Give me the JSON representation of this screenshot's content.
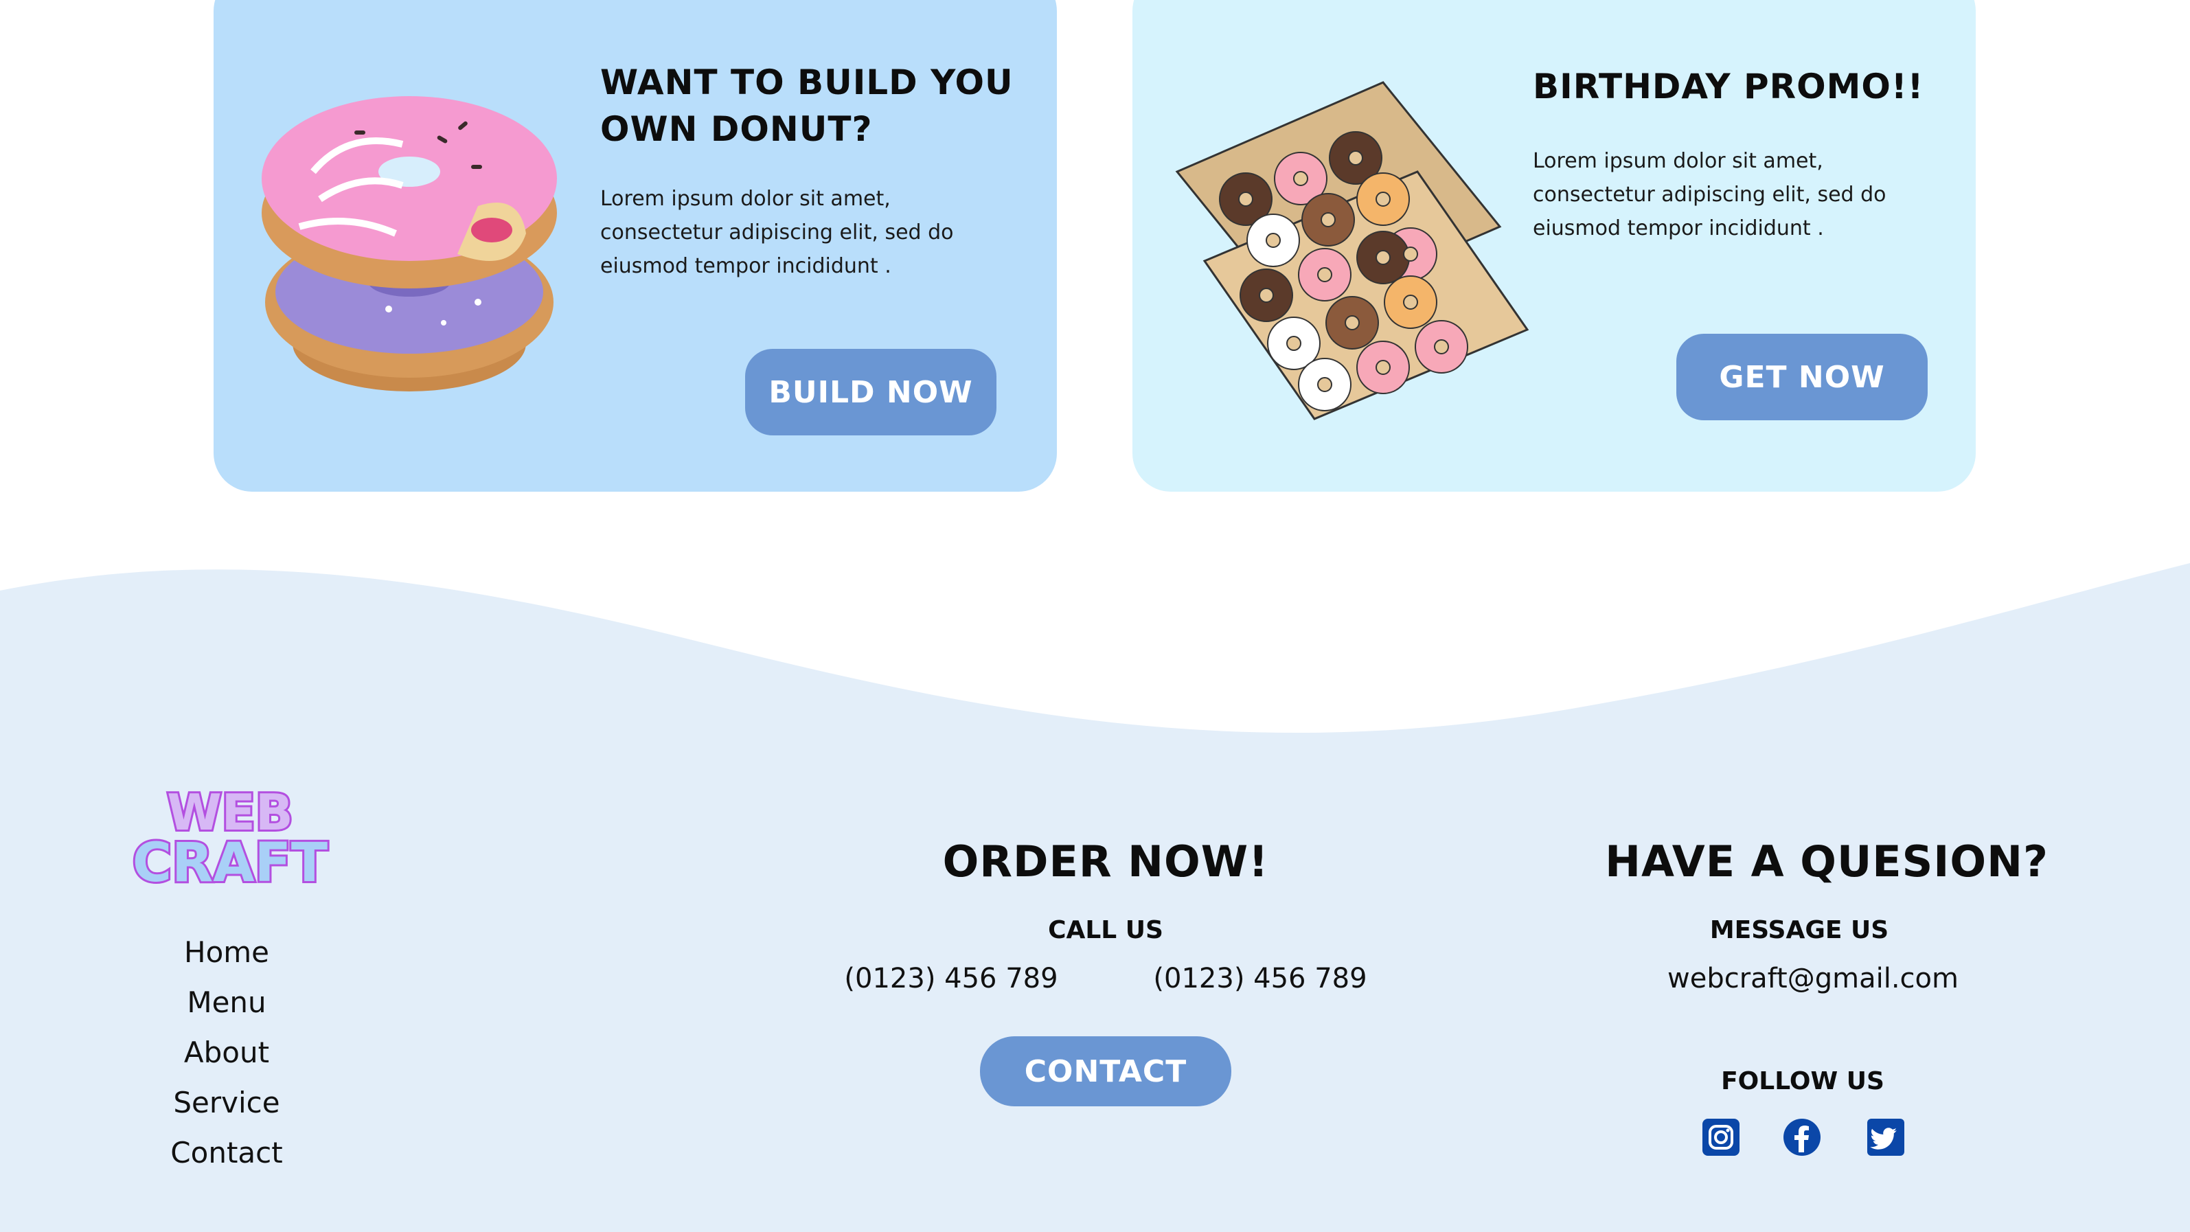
{
  "cards": {
    "build": {
      "title": "WANT TO BUILD YOU OWN DONUT?",
      "text": "Lorem ipsum dolor sit amet, consectetur adipiscing elit, sed do eiusmod tempor incididunt .",
      "button": "BUILD NOW"
    },
    "promo": {
      "title": "BIRTHDAY PROMO!!",
      "text": "Lorem ipsum dolor sit amet, consectetur adipiscing elit, sed do eiusmod tempor incididunt .",
      "button": "GET NOW"
    }
  },
  "footer": {
    "logo": {
      "line1": "WEB",
      "line2": "CRAFT"
    },
    "nav": [
      "Home",
      "Menu",
      "About",
      "Service",
      "Contact"
    ],
    "order": {
      "title": "ORDER NOW!",
      "call_label": "CALL US",
      "phone1": "(0123) 456 789",
      "phone2": "(0123) 456 789",
      "button": "CONTACT"
    },
    "question": {
      "title": "HAVE A QUESION?",
      "message_label": "MESSAGE US",
      "email": "webcraft@gmail.com",
      "follow_label": "FOLLOW US",
      "social": [
        "instagram-icon",
        "facebook-icon",
        "twitter-icon"
      ]
    }
  },
  "colors": {
    "card_build_bg": "#b9defb",
    "card_promo_bg": "#d6f3fd",
    "button": "#6a96d3",
    "footer_bg": "#e3eef9",
    "social_icon": "#0b47a8"
  }
}
